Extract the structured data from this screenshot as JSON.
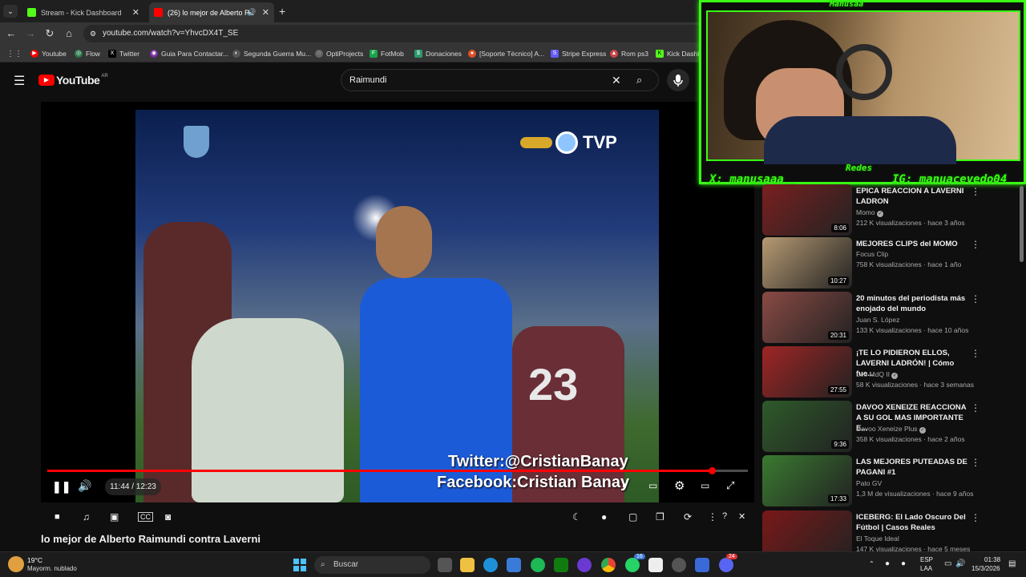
{
  "browser": {
    "tabs": [
      {
        "label": "Stream - Kick Dashboard",
        "active": false
      },
      {
        "label": "(26) lo mejor de Alberto Ra",
        "active": true
      }
    ],
    "new_tab": "+",
    "url": "youtube.com/watch?v=YhvcDX4T_SE",
    "bookmarks": [
      "Youtube",
      "Flow",
      "Twitter",
      "Guia Para Contactar...",
      "Segunda Guerra Mu...",
      "OptiProjects",
      "FotMob",
      "Donaciones",
      "[Soporte Técnico] A...",
      "Stripe Express",
      "Rom ps3",
      "Kick Dashb"
    ]
  },
  "youtube": {
    "logo": "YouTube",
    "region": "AR",
    "search_value": "Raimundi"
  },
  "player": {
    "overlay_logo": "TVP",
    "overlay_twitter": "Twitter:@CristianBanay",
    "overlay_facebook": "Facebook:Cristian Banay",
    "jersey_number": "23",
    "time": "11:44 / 12:23",
    "progress": 0.948
  },
  "video_title": "lo mejor de Alberto Raimundi contra Laverni",
  "webcam": {
    "name": "Manusaa",
    "socials_label": "Redes",
    "x_handle": "X: manusaaa__",
    "ig_handle": "IG: manuacevedo04"
  },
  "recommendations": [
    {
      "title": "EPICA REACCION A LAVERNI LADRON",
      "channel": "Momo",
      "verified": true,
      "meta": "212 K visualizaciones · hace 3 años",
      "duration": "8:06",
      "color": "#7a2020"
    },
    {
      "title": "MEJORES CLIPS del MOMO",
      "channel": "Focus Clip",
      "verified": false,
      "meta": "758 K visualizaciones · hace 1 año",
      "duration": "10:27",
      "color": "#b79a73"
    },
    {
      "title": "20 minutos del periodista más enojado del mundo",
      "channel": "Juan S. López",
      "verified": false,
      "meta": "133 K visualizaciones · hace 10 años",
      "duration": "20:31",
      "color": "#8a4a44"
    },
    {
      "title": "¡TE LO PIDIERON ELLOS, LAVERNI LADRÓN! | Cómo fue...",
      "channel": "Leo MdQ II",
      "verified": true,
      "meta": "58 K visualizaciones · hace 3 semanas",
      "duration": "27:55",
      "color": "#a02424"
    },
    {
      "title": "DAVOO XENEIZE REACCIONA A SU GOL MAS IMPORTANTE E...",
      "channel": "Davoo Xeneize Plus",
      "verified": true,
      "meta": "358 K visualizaciones · hace 2 años",
      "duration": "9:36",
      "color": "#2e5a2a"
    },
    {
      "title": "LAS MEJORES PUTEADAS DE PAGANI #1",
      "channel": "Pato GV",
      "verified": false,
      "meta": "1,3 M de visualizaciones · hace 9 años",
      "duration": "17:33",
      "color": "#3a7a30"
    },
    {
      "title": "ICEBERG: El Lado Oscuro Del Fútbol | Casos Reales",
      "channel": "El Toque Ideal",
      "verified": false,
      "meta": "147 K visualizaciones · hace 5 meses",
      "duration": "",
      "color": "#7a1818"
    }
  ],
  "taskbar": {
    "weather_temp": "19°C",
    "weather_desc": "Mayorm. nublado",
    "search_placeholder": "Buscar",
    "lang_top": "ESP",
    "lang_bottom": "LAA",
    "time": "01:38",
    "date": "15/3/2026",
    "badge_whatsapp": "16",
    "badge_discord": "24"
  }
}
